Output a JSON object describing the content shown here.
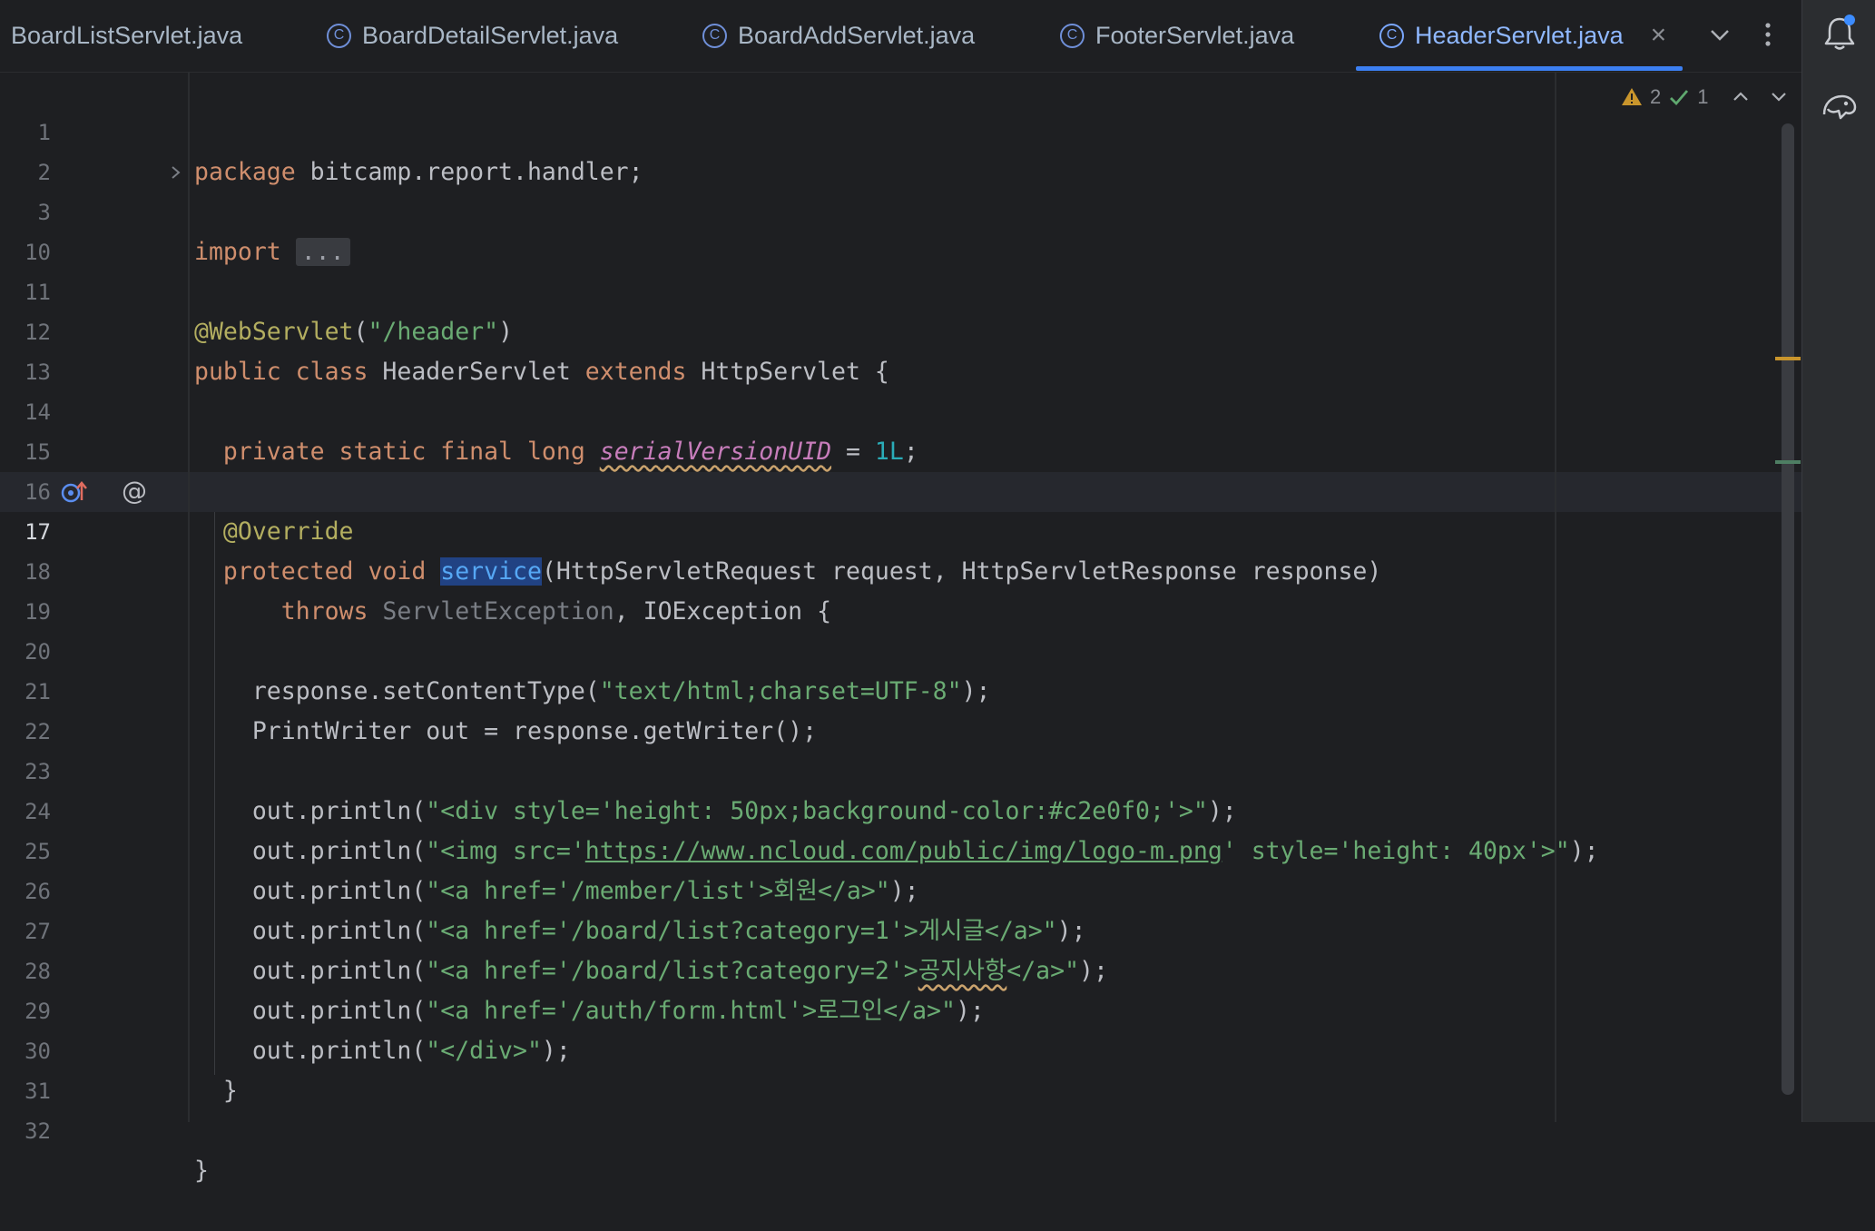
{
  "tabs": [
    {
      "label": "BoardListServlet.java",
      "icon": "class-icon",
      "active": false
    },
    {
      "label": "BoardDetailServlet.java",
      "icon": "class-icon",
      "active": false
    },
    {
      "label": "BoardAddServlet.java",
      "icon": "class-icon",
      "active": false
    },
    {
      "label": "FooterServlet.java",
      "icon": "class-icon",
      "active": false
    },
    {
      "label": "HeaderServlet.java",
      "icon": "class-icon",
      "active": true
    }
  ],
  "tab_close_glyph": "×",
  "class_icon_glyph": "C",
  "inspections": {
    "warnings": "2",
    "ok": "1"
  },
  "fold": {
    "placeholder": "..."
  },
  "editor": {
    "current_line": "17",
    "line_numbers": [
      "1",
      "2",
      "3",
      "10",
      "11",
      "12",
      "13",
      "14",
      "15",
      "16",
      "17",
      "18",
      "19",
      "20",
      "21",
      "22",
      "23",
      "24",
      "25",
      "26",
      "27",
      "28",
      "29",
      "30",
      "31",
      "32"
    ],
    "code": {
      "l1_kw": "package",
      "l1_rest": " bitcamp.report.handler;",
      "l3_kw": "import",
      "l11_ann": "@WebServlet",
      "l11_open": "(",
      "l11_str": "\"/header\"",
      "l11_close": ")",
      "l12_kw1": "public class",
      "l12_name": " HeaderServlet ",
      "l12_kw2": "extends",
      "l12_rest": " HttpServlet {",
      "l14_kw": "private static final long",
      "l14_field": "serialVersionUID",
      "l14_eq": " = ",
      "l14_num": "1L",
      "l14_end": ";",
      "l16_ann": "@Override",
      "l17_kw": "protected void",
      "l17_method": "service",
      "l17_rest": "(HttpServletRequest request, HttpServletResponse response)",
      "l18_kw": "throws",
      "l18_dim": " ServletException",
      "l18_rest": ", IOException {",
      "l20_pre": "response.setContentType(",
      "l20_str": "\"text/html;charset=UTF-8\"",
      "l20_post": ");",
      "l21": "PrintWriter out = response.getWriter();",
      "l23_pre": "out.println(",
      "l23_str": "\"<div style='height: 50px;background-color:#c2e0f0;'>\"",
      "l23_post": ");",
      "l24_pre": "out.println(",
      "l24_str1": "\"<img src='",
      "l24_link": "https://www.ncloud.com/public/img/logo-m.png",
      "l24_str2": "' style='height: 40px'>\"",
      "l24_post": ");",
      "l25_pre": "out.println(",
      "l25_str": "\"<a href='/member/list'>회원</a>\"",
      "l25_post": ");",
      "l26_pre": "out.println(",
      "l26_str": "\"<a href='/board/list?category=1'>게시글</a>\"",
      "l26_post": ");",
      "l27_pre": "out.println(",
      "l27_str1": "\"<a href='/board/list?category=2'>",
      "l27_wavy": "공지사항",
      "l27_str2": "</a>\"",
      "l27_post": ");",
      "l28_pre": "out.println(",
      "l28_str": "\"<a href='/auth/form.html'>로그인</a>\"",
      "l28_post": ");",
      "l29_pre": "out.println(",
      "l29_str": "\"</div>\"",
      "l29_post": ");",
      "l30": "}",
      "l32": "}"
    }
  },
  "colors": {
    "background": "#1e1f22",
    "keyword": "#cf8e6d",
    "string": "#6aab73",
    "annotation": "#b3ae60",
    "number": "#2aacb8",
    "static_field": "#c77dbb",
    "accent": "#3c7ff2"
  }
}
